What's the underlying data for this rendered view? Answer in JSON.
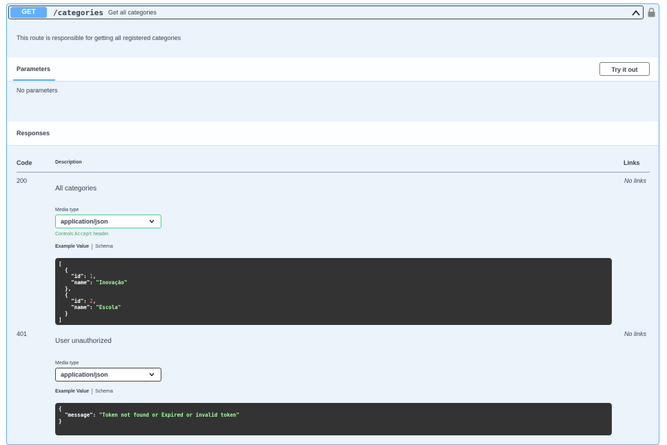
{
  "endpoint": {
    "method": "GET",
    "path": "/categories",
    "summary": "Get all categories",
    "description": "This route is responsible for getting all registered categories"
  },
  "parameters": {
    "title": "Parameters",
    "try_label": "Try it out",
    "empty_text": "No parameters"
  },
  "responses": {
    "title": "Responses",
    "columns": {
      "code": "Code",
      "description": "Description",
      "links": "Links"
    },
    "items": [
      {
        "code": "200",
        "description": "All categories",
        "links": "No links",
        "media_type_label": "Media type",
        "media_type": "application/json",
        "controls_prefix": "Controls ",
        "controls_code": "Accept",
        "controls_suffix": " header.",
        "example_tab": "Example Value",
        "schema_tab": "Schema",
        "example": {
          "open": "[",
          "obj_open": "{",
          "id_key": "\"id\"",
          "name_key": "\"name\"",
          "items": [
            {
              "id": "1",
              "name": "\"Inovação\""
            },
            {
              "id": "2",
              "name": "\"Escola\""
            }
          ],
          "close": "]"
        }
      },
      {
        "code": "401",
        "description": "User unauthorized",
        "links": "No links",
        "media_type_label": "Media type",
        "media_type": "application/json",
        "example_tab": "Example Value",
        "schema_tab": "Schema",
        "example": {
          "message_key": "\"message\"",
          "message_value": "\"Token not found or Expired or invalid token\""
        }
      }
    ]
  },
  "icons": {
    "collapse": "chevron-up-icon",
    "lock": "lock-icon",
    "select": "chevron-down-icon"
  },
  "colors": {
    "get_accent": "#61affe",
    "block_bg": "#ebf3fb",
    "code_bg": "#333333",
    "string": "#a2fca2",
    "number": "#d36363",
    "success": "#49cc90"
  }
}
